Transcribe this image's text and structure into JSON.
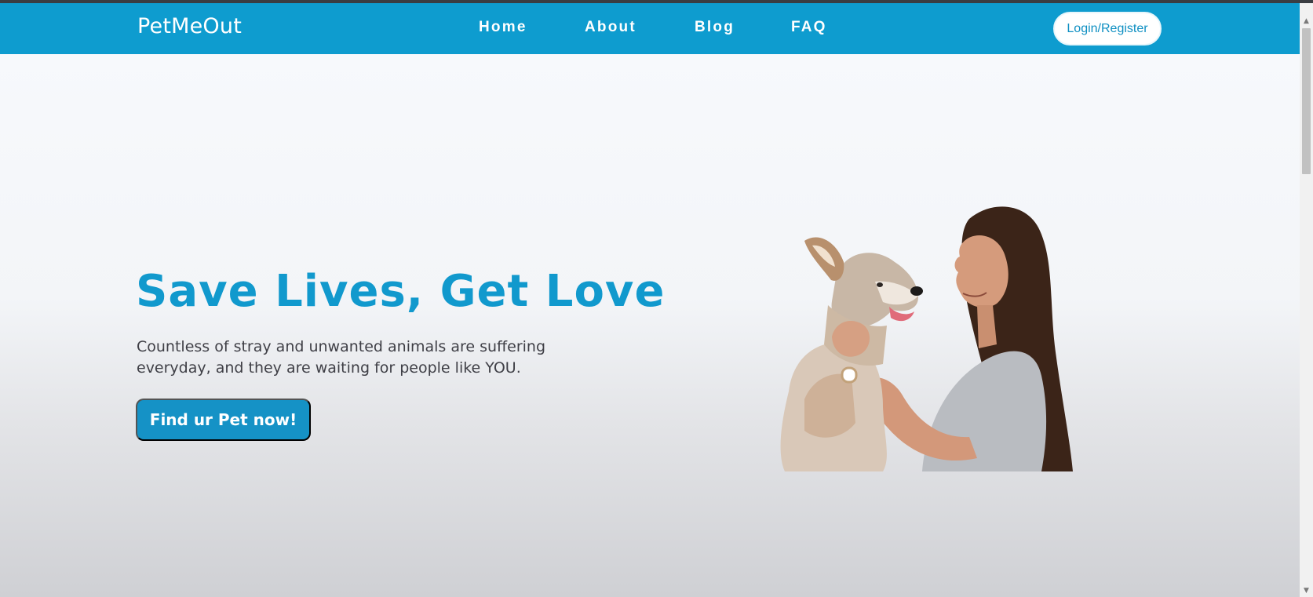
{
  "navbar": {
    "brand": "PetMeOut",
    "links": [
      "Home",
      "About",
      "Blog",
      "FAQ"
    ],
    "login_label": "Login/Register",
    "background": "#0e9ccf"
  },
  "hero": {
    "headline": "Save Lives, Get Love",
    "subtext_line1": "Countless of stray and unwanted animals are suffering",
    "subtext_line2": "everyday, and they are waiting for people like YOU.",
    "cta_label": "Find ur Pet now!",
    "accent": "#1199cd"
  },
  "scrollbar": {
    "up_icon": "▲",
    "down_icon": "▼"
  }
}
